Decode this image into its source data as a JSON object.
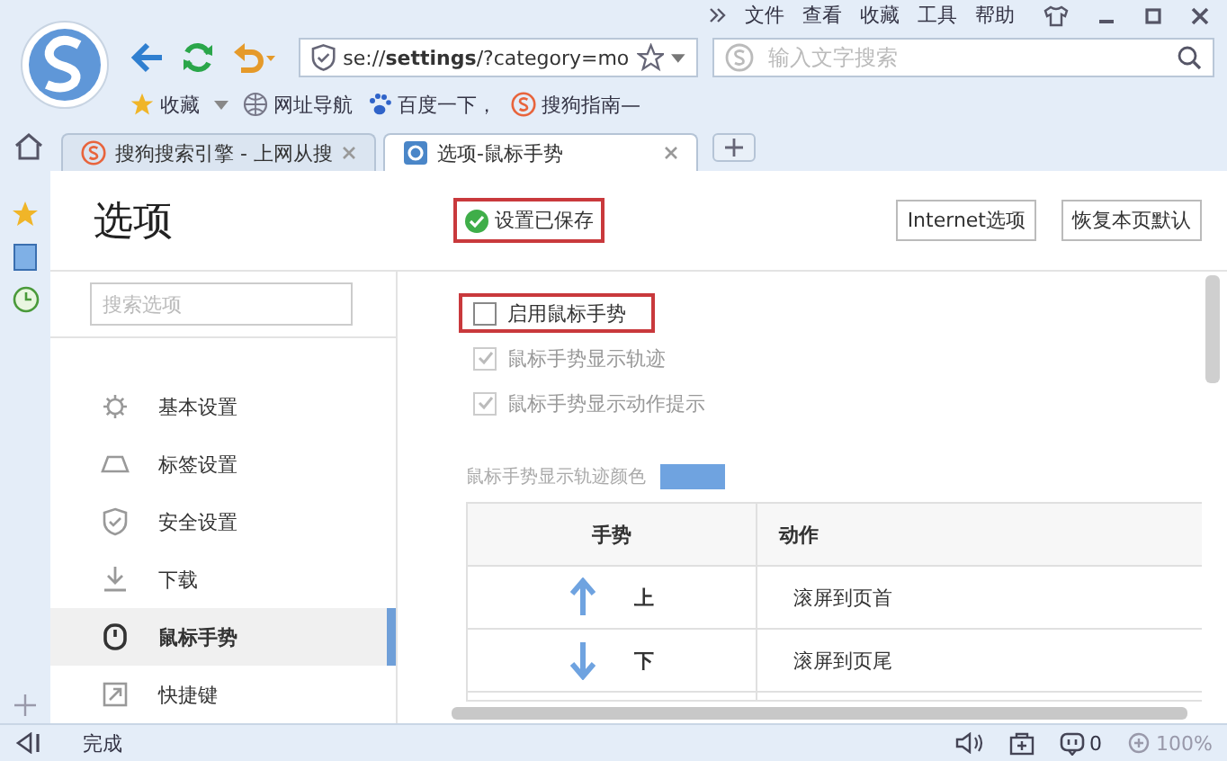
{
  "menu": [
    "文件",
    "查看",
    "收藏",
    "工具",
    "帮助"
  ],
  "address": {
    "prefix": "se://",
    "bold": "settings",
    "rest": "/?category=mo"
  },
  "search": {
    "placeholder": "输入文字搜索"
  },
  "bookmarks": [
    {
      "label": "收藏"
    },
    {
      "label": "网址导航"
    },
    {
      "label": "百度一下，"
    },
    {
      "label": "搜狗指南—"
    }
  ],
  "tabs": [
    {
      "label": "搜狗搜索引擎 - 上网从搜",
      "selected": false
    },
    {
      "label": "选项-鼠标手势",
      "selected": true
    }
  ],
  "page": {
    "title": "选项",
    "saved_status": {
      "text": "设置已保存",
      "highlighted": true
    },
    "buttons": [
      "Internet选项",
      "恢复本页默认"
    ]
  },
  "sidebar": {
    "search_placeholder": "搜索选项",
    "items": [
      {
        "label": "基本设置",
        "selected": false
      },
      {
        "label": "标签设置",
        "selected": false
      },
      {
        "label": "安全设置",
        "selected": false
      },
      {
        "label": "下载",
        "selected": false
      },
      {
        "label": "鼠标手势",
        "selected": true
      },
      {
        "label": "快捷键",
        "selected": false
      }
    ]
  },
  "options": [
    {
      "label": "启用鼠标手势",
      "checked": false,
      "disabled": false,
      "highlighted": true
    },
    {
      "label": "鼠标手势显示轨迹",
      "checked": true,
      "disabled": true,
      "highlighted": false
    },
    {
      "label": "鼠标手势显示动作提示",
      "checked": true,
      "disabled": true,
      "highlighted": false
    }
  ],
  "trail_color": {
    "label": "鼠标手势显示轨迹颜色",
    "color": "#6fa3e0"
  },
  "table": {
    "columns": [
      "手势",
      "动作"
    ],
    "rows": [
      {
        "kind": "up",
        "gesture": "上",
        "action": "滚屏到页首"
      },
      {
        "kind": "down",
        "gesture": "下",
        "action": "滚屏到页尾"
      }
    ]
  },
  "status_bar": {
    "text": "完成",
    "count": "0",
    "zoom": "100%"
  }
}
